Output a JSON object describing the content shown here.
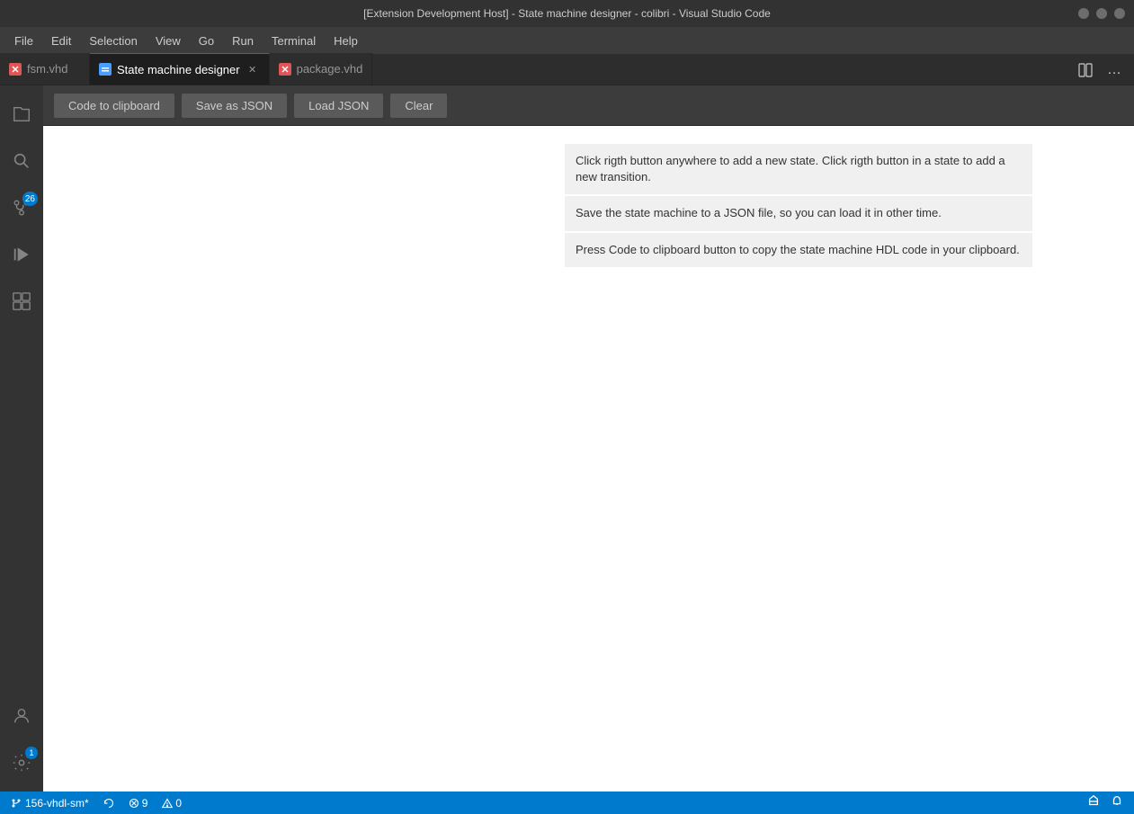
{
  "titlebar": {
    "title": "[Extension Development Host] - State machine designer - colibri - Visual Studio Code"
  },
  "menubar": {
    "items": [
      "File",
      "Edit",
      "Selection",
      "View",
      "Go",
      "Run",
      "Terminal",
      "Help"
    ]
  },
  "tabs": [
    {
      "id": "fsm",
      "label": "fsm.vhd",
      "icon": "fsm-icon",
      "active": false,
      "closeable": false
    },
    {
      "id": "designer",
      "label": "State machine designer",
      "icon": "designer-icon",
      "active": true,
      "closeable": true
    },
    {
      "id": "package",
      "label": "package.vhd",
      "icon": "package-icon",
      "active": false,
      "closeable": false
    }
  ],
  "toolbar": {
    "buttons": [
      {
        "id": "code-to-clipboard",
        "label": "Code to clipboard"
      },
      {
        "id": "save-as-json",
        "label": "Save as JSON"
      },
      {
        "id": "load-json",
        "label": "Load JSON"
      },
      {
        "id": "clear",
        "label": "Clear"
      }
    ]
  },
  "info_panel": {
    "messages": [
      "Click rigth button anywhere to add a new state. Click rigth button in a state to add a new transition.",
      "Save the state machine to a JSON file, so you can load it in other time.",
      "Press Code to clipboard button to copy the state machine HDL code in your clipboard."
    ]
  },
  "activitybar": {
    "items": [
      {
        "id": "explorer",
        "icon": "files-icon",
        "active": false
      },
      {
        "id": "search",
        "icon": "search-icon",
        "active": false
      },
      {
        "id": "source-control",
        "icon": "source-control-icon",
        "active": false,
        "badge": "26"
      },
      {
        "id": "run",
        "icon": "run-icon",
        "active": false
      },
      {
        "id": "extensions",
        "icon": "extensions-icon",
        "active": false
      }
    ],
    "bottom_items": [
      {
        "id": "account",
        "icon": "account-icon"
      },
      {
        "id": "settings",
        "icon": "settings-icon",
        "badge": "1"
      }
    ]
  },
  "statusbar": {
    "branch": "156-vhdl-sm*",
    "sync_icon": "sync-icon",
    "errors": "9",
    "warnings": "0",
    "right_items": [
      "notification-icon",
      "bell-icon"
    ]
  }
}
